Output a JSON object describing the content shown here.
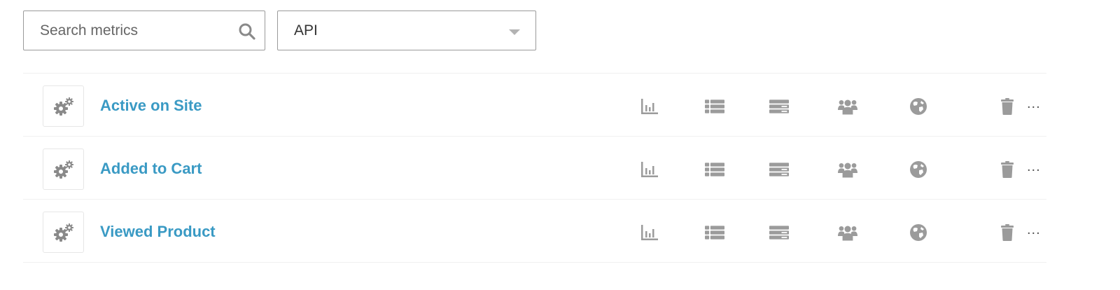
{
  "search": {
    "placeholder": "Search metrics",
    "value": "",
    "icon": "search-icon"
  },
  "filter": {
    "selected": "API",
    "icon": "chevron-down-icon"
  },
  "metrics": [
    {
      "name": "Active on Site"
    },
    {
      "name": "Added to Cart"
    },
    {
      "name": "Viewed Product"
    }
  ],
  "row_actions": {
    "more_label": "...",
    "icons": [
      "bar-chart-icon",
      "list-icon",
      "stacked-rows-icon",
      "users-icon",
      "globe-icon",
      "trash-icon"
    ]
  },
  "colors": {
    "link": "#3a9ac4",
    "icon": "#9b9b9b",
    "border": "#9a9a9a",
    "divider": "#f0f0f0"
  }
}
